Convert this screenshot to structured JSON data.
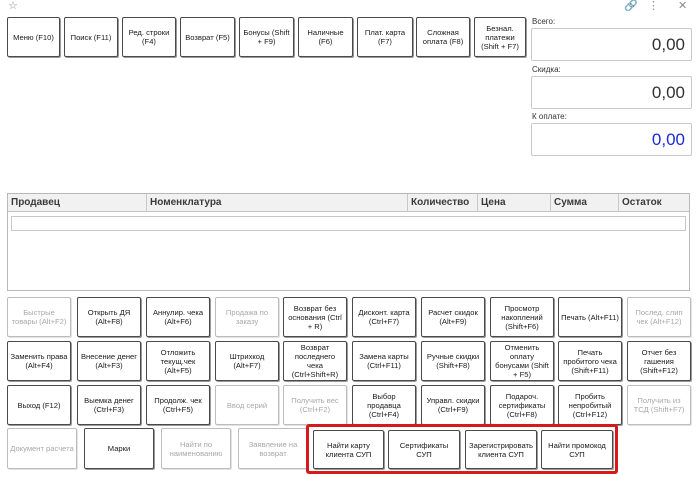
{
  "toolbar_top": [
    {
      "label": "Меню (F10)",
      "enabled": true
    },
    {
      "label": "Поиск (F11)",
      "enabled": true
    },
    {
      "label": "Ред. строки (F4)",
      "enabled": true
    },
    {
      "label": "Возврат (F5)",
      "enabled": true
    },
    {
      "label": "Бонусы (Shift + F9)",
      "enabled": true
    },
    {
      "label": "Наличные (F6)",
      "enabled": true
    },
    {
      "label": "Плат. карта (F7)",
      "enabled": true
    },
    {
      "label": "Сложная оплата (F8)",
      "enabled": true
    },
    {
      "label": "Безнал. платежи (Shift + F7)",
      "enabled": true
    }
  ],
  "totals": {
    "total_label": "Всего:",
    "total_value": "0,00",
    "discount_label": "Скидка:",
    "discount_value": "0,00",
    "pay_label": "К оплате:",
    "pay_value": "0,00",
    "pay_color": "#1a2bd6"
  },
  "table": {
    "columns": [
      "Продавец",
      "Номенклатура",
      "Количество",
      "Цена",
      "Сумма",
      "Остаток"
    ]
  },
  "grid": {
    "row1": [
      {
        "label": "Быстрые товары (Alt+F2)",
        "enabled": false
      },
      {
        "label": "Открыть ДЯ (Alt+F8)",
        "enabled": true
      },
      {
        "label": "Аннулир. чека (Alt+F6)",
        "enabled": true
      },
      {
        "label": "Продажа по заказу",
        "enabled": false
      },
      {
        "label": "Возврат без основания (Ctrl + R)",
        "enabled": true
      },
      {
        "label": "Дисконт. карта (Ctrl+F7)",
        "enabled": true
      },
      {
        "label": "Расчет скидок (Alt+F9)",
        "enabled": true
      },
      {
        "label": "Просмотр накоплений (Shift+F6)",
        "enabled": true
      },
      {
        "label": "Печать (Alt+F11)",
        "enabled": true
      },
      {
        "label": "Послед. слип чек (Alt+F12)",
        "enabled": false
      }
    ],
    "row2": [
      {
        "label": "Заменить права (Alt+F4)",
        "enabled": true
      },
      {
        "label": "Внесение денег (Alt+F3)",
        "enabled": true
      },
      {
        "label": "Отложить текущ.чек (Alt+F5)",
        "enabled": true
      },
      {
        "label": "Штрихкод (Alt+F7)",
        "enabled": true
      },
      {
        "label": "Возврат последнего чека (Ctrl+Shift+R)",
        "enabled": true
      },
      {
        "label": "Замена карты (Ctrl+F11)",
        "enabled": true
      },
      {
        "label": "Ручные скидки (Shift+F8)",
        "enabled": true
      },
      {
        "label": "Отменить оплату бонусами (Shift + F5)",
        "enabled": true
      },
      {
        "label": "Печать пробитого чека (Shift+F11)",
        "enabled": true
      },
      {
        "label": "Отчет без гашения (Shift+F12)",
        "enabled": true
      }
    ],
    "row3": [
      {
        "label": "Выход (F12)",
        "enabled": true
      },
      {
        "label": "Выемка денег (Ctrl+F3)",
        "enabled": true
      },
      {
        "label": "Продолж. чек (Ctrl+F5)",
        "enabled": true
      },
      {
        "label": "Ввод серий",
        "enabled": false
      },
      {
        "label": "Получить вес (Ctrl+F2)",
        "enabled": false
      },
      {
        "label": "Выбор продавца (Ctrl+F4)",
        "enabled": true
      },
      {
        "label": "Управл. скидки (Ctrl+F9)",
        "enabled": true
      },
      {
        "label": "Подароч. сертификаты (Ctrl+F8)",
        "enabled": true
      },
      {
        "label": "Пробить непробитый (Ctrl+F12)",
        "enabled": true
      },
      {
        "label": "Получить из ТСД (Shift+F7)",
        "enabled": false
      }
    ],
    "row4": [
      {
        "label": "Документ расчета",
        "enabled": false
      },
      {
        "label": "Марки",
        "enabled": true
      },
      {
        "label": "Найти по наименованию",
        "enabled": false
      },
      {
        "label": "Заявление на возврат",
        "enabled": false
      },
      {
        "label": "Найти карту клиента СУП",
        "enabled": true
      },
      {
        "label": "Сертификаты СУП",
        "enabled": true
      },
      {
        "label": "Зарегистрировать клиента СУП",
        "enabled": true
      },
      {
        "label": "Найти промокод СУП",
        "enabled": true
      }
    ]
  },
  "icons": {
    "favorite": "☆",
    "link": "🔗",
    "more": "⋮",
    "close": "✕"
  }
}
